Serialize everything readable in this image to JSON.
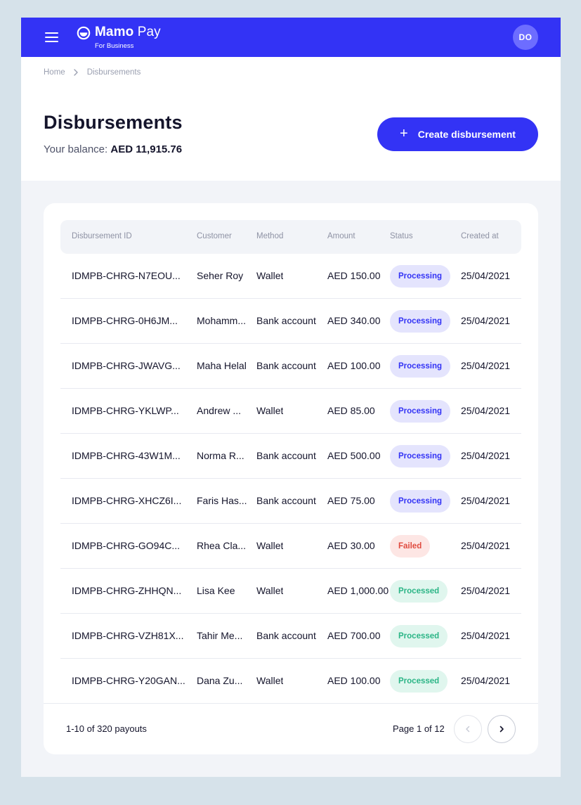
{
  "brand": {
    "name_bold": "Mamo",
    "name_light": "Pay",
    "subtitle": "For Business",
    "color": "#3333f5"
  },
  "user": {
    "initials": "DO"
  },
  "breadcrumb": [
    {
      "label": "Home"
    },
    {
      "label": "Disbursements"
    }
  ],
  "page": {
    "title": "Disbursements",
    "balance_label": "Your balance:",
    "balance_value": "AED 11,915.76",
    "create_button": "Create disbursement"
  },
  "table": {
    "columns": [
      "Disbursement ID",
      "Customer",
      "Method",
      "Amount",
      "Status",
      "Created at"
    ],
    "rows": [
      {
        "id": "IDMPB-CHRG-N7EOU...",
        "customer": "Seher Roy",
        "method": "Wallet",
        "amount": "AED 150.00",
        "status": "Processing",
        "status_type": "processing",
        "created": "25/04/2021"
      },
      {
        "id": "IDMPB-CHRG-0H6JM...",
        "customer": "Mohamm...",
        "method": "Bank account",
        "amount": "AED 340.00",
        "status": "Processing",
        "status_type": "processing",
        "created": "25/04/2021"
      },
      {
        "id": "IDMPB-CHRG-JWAVG...",
        "customer": "Maha Helal",
        "method": "Bank account",
        "amount": "AED 100.00",
        "status": "Processing",
        "status_type": "processing",
        "created": "25/04/2021"
      },
      {
        "id": "IDMPB-CHRG-YKLWP...",
        "customer": "Andrew ...",
        "method": "Wallet",
        "amount": "AED 85.00",
        "status": "Processing",
        "status_type": "processing",
        "created": "25/04/2021"
      },
      {
        "id": "IDMPB-CHRG-43W1M...",
        "customer": "Norma R...",
        "method": "Bank account",
        "amount": "AED 500.00",
        "status": "Processing",
        "status_type": "processing",
        "created": "25/04/2021"
      },
      {
        "id": "IDMPB-CHRG-XHCZ6I...",
        "customer": "Faris Has...",
        "method": "Bank account",
        "amount": "AED 75.00",
        "status": "Processing",
        "status_type": "processing",
        "created": "25/04/2021"
      },
      {
        "id": "IDMPB-CHRG-GO94C...",
        "customer": "Rhea Cla...",
        "method": "Wallet",
        "amount": "AED 30.00",
        "status": "Failed",
        "status_type": "failed",
        "created": "25/04/2021"
      },
      {
        "id": "IDMPB-CHRG-ZHHQN...",
        "customer": "Lisa Kee",
        "method": "Wallet",
        "amount": "AED 1,000.00",
        "status": "Processed",
        "status_type": "processed",
        "created": "25/04/2021"
      },
      {
        "id": "IDMPB-CHRG-VZH81X...",
        "customer": "Tahir Me...",
        "method": "Bank account",
        "amount": "AED 700.00",
        "status": "Processed",
        "status_type": "processed",
        "created": "25/04/2021"
      },
      {
        "id": "IDMPB-CHRG-Y20GAN...",
        "customer": "Dana Zu...",
        "method": "Wallet",
        "amount": "AED 100.00",
        "status": "Processed",
        "status_type": "processed",
        "created": "25/04/2021"
      }
    ]
  },
  "pagination": {
    "summary": "1-10 of 320 payouts",
    "page_label": "Page 1 of 12",
    "prev_icon": "chevron-left-icon",
    "next_icon": "chevron-right-icon"
  }
}
